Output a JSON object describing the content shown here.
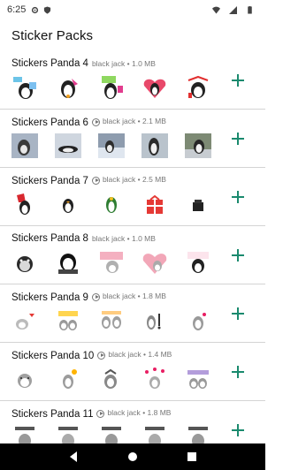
{
  "status": {
    "time": "6:25",
    "icons": [
      "gear-icon",
      "shield-icon",
      "wifi-icon",
      "signal-icon",
      "battery-icon"
    ]
  },
  "app": {
    "title": "Sticker Packs"
  },
  "packs": [
    {
      "name": "Stickers Panda 4",
      "publisher": "black jack",
      "size": "1.0 MB",
      "has_preview_icon": false
    },
    {
      "name": "Stickers Panda 6",
      "publisher": "black jack",
      "size": "2.1 MB",
      "has_preview_icon": true
    },
    {
      "name": "Stickers Panda 7",
      "publisher": "black jack",
      "size": "2.5 MB",
      "has_preview_icon": true
    },
    {
      "name": "Stickers Panda 8",
      "publisher": "black jack",
      "size": "1.0 MB",
      "has_preview_icon": false
    },
    {
      "name": "Stickers Panda 9",
      "publisher": "black jack",
      "size": "1.8 MB",
      "has_preview_icon": true
    },
    {
      "name": "Stickers Panda 10",
      "publisher": "black jack",
      "size": "1.4 MB",
      "has_preview_icon": true
    },
    {
      "name": "Stickers Panda 11",
      "publisher": "black jack",
      "size": "1.8 MB",
      "has_preview_icon": true
    }
  ],
  "separator": "•",
  "colors": {
    "accent": "#1a8a6e",
    "divider": "#d4d4d4",
    "nav_bar": "#000000"
  },
  "nav": [
    "back-icon",
    "home-icon",
    "recents-icon"
  ]
}
